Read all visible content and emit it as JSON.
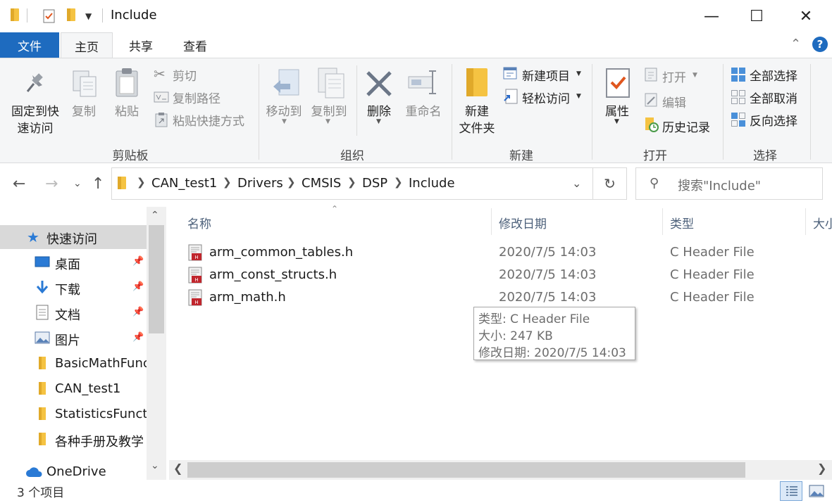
{
  "window": {
    "title": "Include",
    "minimize": "—",
    "maximize": "☐",
    "close": "✕"
  },
  "tabs": {
    "file": "文件",
    "home": "主页",
    "share": "共享",
    "view": "查看"
  },
  "ribbon": {
    "clipboard": {
      "pin_line1": "固定到快",
      "pin_line2": "速访问",
      "copy": "复制",
      "paste": "粘贴",
      "cut": "剪切",
      "copy_path": "复制路径",
      "paste_shortcut": "粘贴快捷方式",
      "label": "剪贴板"
    },
    "organize": {
      "move_to": "移动到",
      "copy_to": "复制到",
      "delete": "删除",
      "rename": "重命名",
      "label": "组织"
    },
    "new": {
      "new_folder_line1": "新建",
      "new_folder_line2": "文件夹",
      "new_item": "新建项目",
      "easy_access": "轻松访问",
      "label": "新建"
    },
    "open": {
      "properties": "属性",
      "open": "打开",
      "edit": "编辑",
      "history": "历史记录",
      "label": "打开"
    },
    "select": {
      "select_all": "全部选择",
      "select_none": "全部取消",
      "invert": "反向选择",
      "label": "选择"
    }
  },
  "address": {
    "crumbs": [
      "CAN_test1",
      "Drivers",
      "CMSIS",
      "DSP",
      "Include"
    ],
    "search_placeholder": "搜索\"Include\""
  },
  "nav": {
    "quick_access": "快速访问",
    "items": [
      {
        "label": "桌面",
        "icon": "desktop-icon",
        "pinned": true
      },
      {
        "label": "下载",
        "icon": "download-icon",
        "pinned": true
      },
      {
        "label": "文档",
        "icon": "document-icon",
        "pinned": true
      },
      {
        "label": "图片",
        "icon": "picture-icon",
        "pinned": true
      },
      {
        "label": "BasicMathFunc",
        "icon": "folder-icon",
        "pinned": false
      },
      {
        "label": "CAN_test1",
        "icon": "folder-icon",
        "pinned": false
      },
      {
        "label": "StatisticsFuncti",
        "icon": "folder-icon",
        "pinned": false
      },
      {
        "label": "各种手册及教学",
        "icon": "folder-icon",
        "pinned": false
      }
    ],
    "onedrive": "OneDrive"
  },
  "columns": {
    "name": "名称",
    "modified": "修改日期",
    "type": "类型",
    "size": "大小"
  },
  "files": [
    {
      "name": "arm_common_tables.h",
      "modified": "2020/7/5 14:03",
      "type": "C Header File"
    },
    {
      "name": "arm_const_structs.h",
      "modified": "2020/7/5 14:03",
      "type": "C Header File"
    },
    {
      "name": "arm_math.h",
      "modified": "2020/7/5 14:03",
      "type": "C Header File"
    }
  ],
  "tooltip": {
    "type": "类型: C Header File",
    "size": "大小: 247 KB",
    "modified": "修改日期: 2020/7/5 14:03"
  },
  "status": {
    "count": "3 个项目"
  },
  "colors": {
    "accent": "#1e6bbf",
    "folder": "#f5c342",
    "selected": "#d9d9d9"
  }
}
